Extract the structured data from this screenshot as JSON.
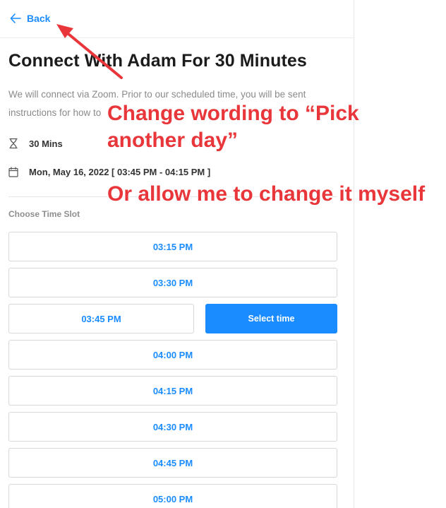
{
  "header": {
    "back_label": "Back"
  },
  "event": {
    "title": "Connect With Adam For 30 Minutes",
    "description_line1": "We will connect via Zoom. Prior to our scheduled time, you will be sent",
    "description_line2": "instructions for how to",
    "description_tail": "o",
    "duration": "30 Mins",
    "datetime": "Mon, May 16, 2022 [ 03:45 PM - 04:15 PM ]"
  },
  "slots_section": {
    "label": "Choose Time Slot",
    "select_button": "Select time",
    "slots": [
      "03:15 PM",
      "03:30 PM",
      "03:45 PM",
      "04:00 PM",
      "04:15 PM",
      "04:30 PM",
      "04:45 PM",
      "05:00 PM"
    ],
    "selected_index": 2
  },
  "annotations": {
    "line1": "Change wording to “Pick",
    "line2": "another day”",
    "line3": "Or allow me to change it myself"
  },
  "colors": {
    "accent": "#1a8cff",
    "annotation": "#e8363a"
  }
}
